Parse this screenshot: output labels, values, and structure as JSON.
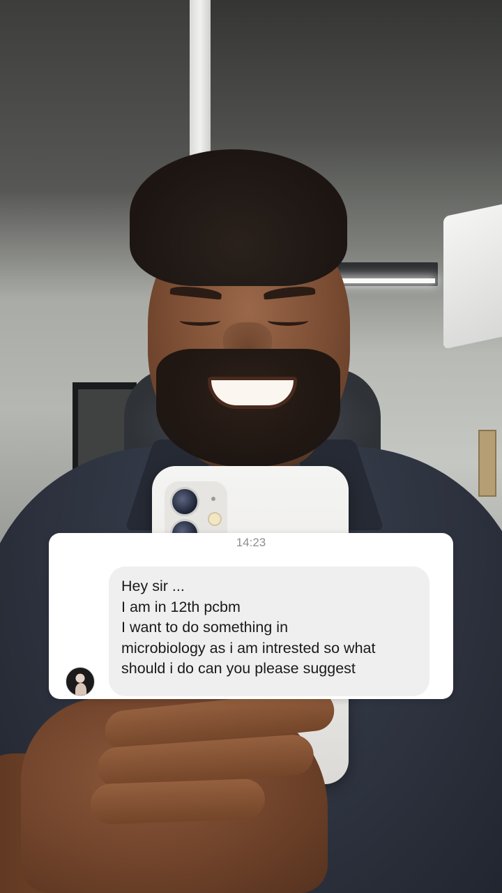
{
  "message_card": {
    "timestamp": "14:23",
    "sender_avatar": "profile-photo",
    "lines": [
      "Hey sir ...",
      "I am in 12th pcbm",
      "I want to do something in",
      "microbiology as i am intrested so what",
      "should i do can you please suggest"
    ]
  },
  "colors": {
    "card_background": "#ffffff",
    "bubble_background": "#efefef",
    "timestamp_text": "#8e8e8e",
    "message_text": "#1a1a1a"
  }
}
